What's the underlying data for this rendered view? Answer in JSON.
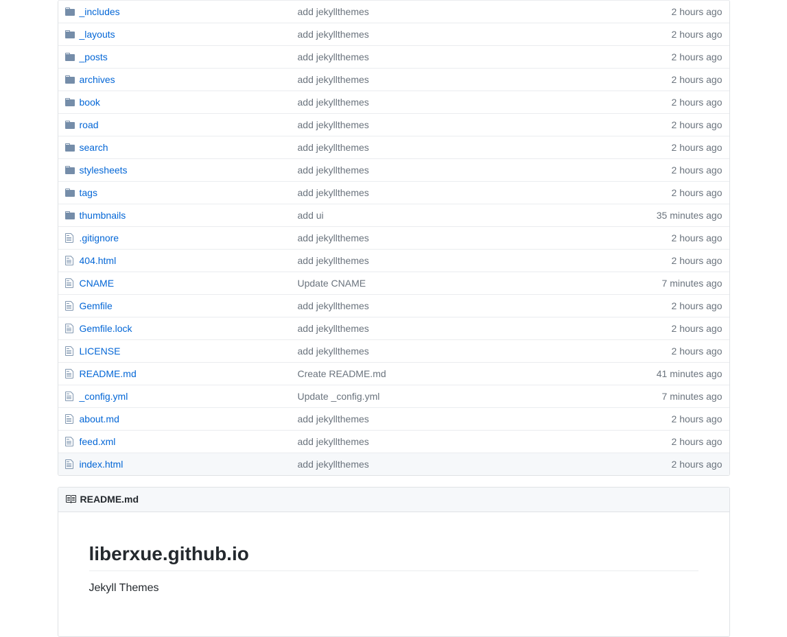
{
  "files": [
    {
      "type": "dir",
      "name": "_includes",
      "message": "add jekyllthemes",
      "age": "2 hours ago"
    },
    {
      "type": "dir",
      "name": "_layouts",
      "message": "add jekyllthemes",
      "age": "2 hours ago"
    },
    {
      "type": "dir",
      "name": "_posts",
      "message": "add jekyllthemes",
      "age": "2 hours ago"
    },
    {
      "type": "dir",
      "name": "archives",
      "message": "add jekyllthemes",
      "age": "2 hours ago"
    },
    {
      "type": "dir",
      "name": "book",
      "message": "add jekyllthemes",
      "age": "2 hours ago"
    },
    {
      "type": "dir",
      "name": "road",
      "message": "add jekyllthemes",
      "age": "2 hours ago"
    },
    {
      "type": "dir",
      "name": "search",
      "message": "add jekyllthemes",
      "age": "2 hours ago"
    },
    {
      "type": "dir",
      "name": "stylesheets",
      "message": "add jekyllthemes",
      "age": "2 hours ago"
    },
    {
      "type": "dir",
      "name": "tags",
      "message": "add jekyllthemes",
      "age": "2 hours ago"
    },
    {
      "type": "dir",
      "name": "thumbnails",
      "message": "add ui",
      "age": "35 minutes ago"
    },
    {
      "type": "file",
      "name": ".gitignore",
      "message": "add jekyllthemes",
      "age": "2 hours ago"
    },
    {
      "type": "file",
      "name": "404.html",
      "message": "add jekyllthemes",
      "age": "2 hours ago"
    },
    {
      "type": "file",
      "name": "CNAME",
      "message": "Update CNAME",
      "age": "7 minutes ago"
    },
    {
      "type": "file",
      "name": "Gemfile",
      "message": "add jekyllthemes",
      "age": "2 hours ago"
    },
    {
      "type": "file",
      "name": "Gemfile.lock",
      "message": "add jekyllthemes",
      "age": "2 hours ago"
    },
    {
      "type": "file",
      "name": "LICENSE",
      "message": "add jekyllthemes",
      "age": "2 hours ago"
    },
    {
      "type": "file",
      "name": "README.md",
      "message": "Create README.md",
      "age": "41 minutes ago"
    },
    {
      "type": "file",
      "name": "_config.yml",
      "message": "Update _config.yml",
      "age": "7 minutes ago"
    },
    {
      "type": "file",
      "name": "about.md",
      "message": "add jekyllthemes",
      "age": "2 hours ago"
    },
    {
      "type": "file",
      "name": "feed.xml",
      "message": "add jekyllthemes",
      "age": "2 hours ago"
    },
    {
      "type": "file",
      "name": "index.html",
      "message": "add jekyllthemes",
      "age": "2 hours ago"
    }
  ],
  "readme": {
    "filename": "README.md",
    "heading": "liberxue.github.io",
    "body": "Jekyll Themes"
  }
}
